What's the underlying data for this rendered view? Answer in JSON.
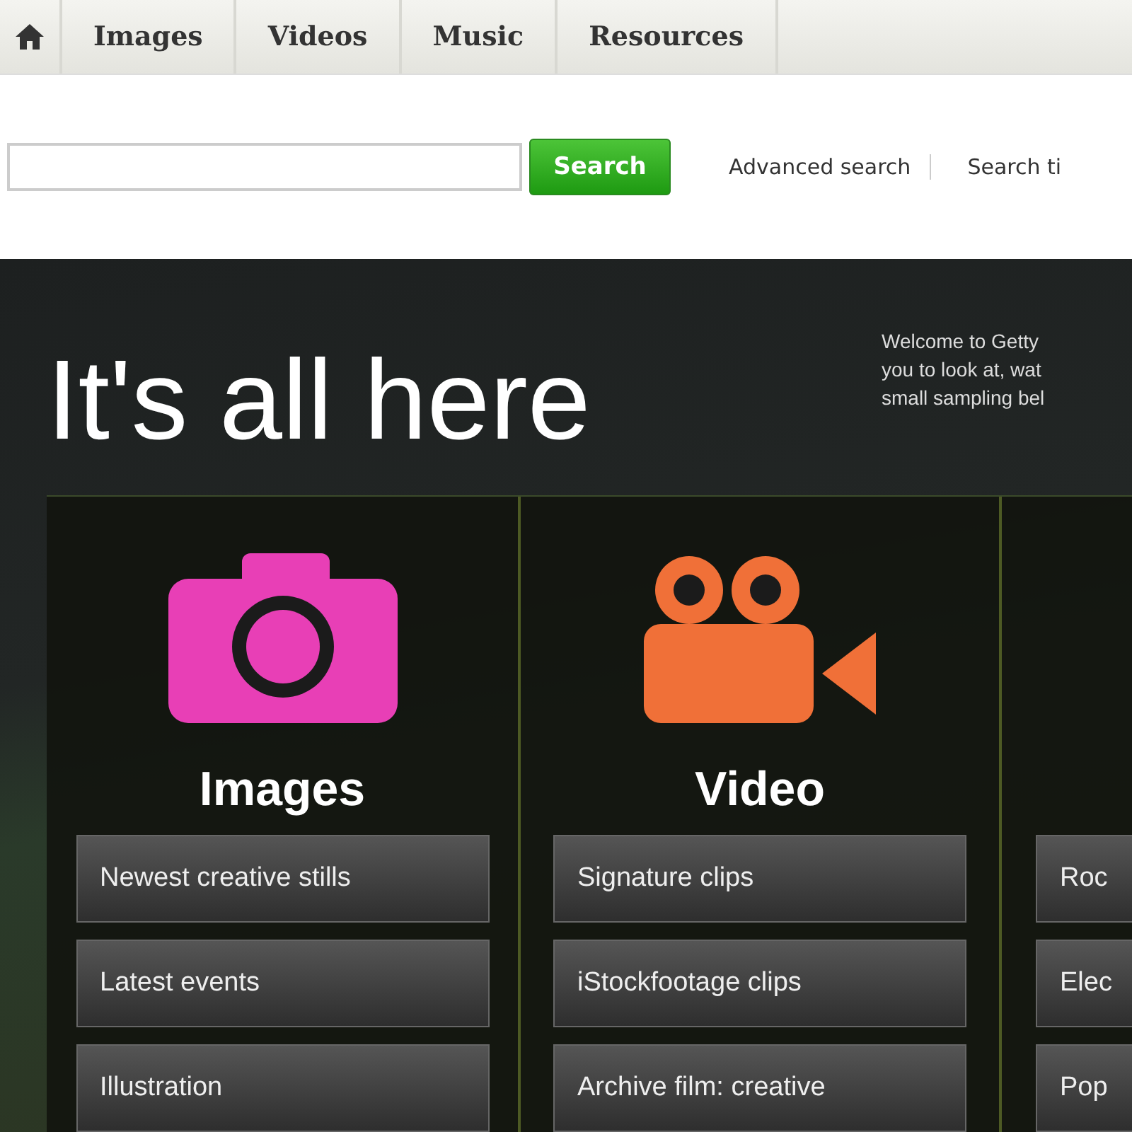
{
  "nav": {
    "tabs": [
      "Images",
      "Videos",
      "Music",
      "Resources"
    ]
  },
  "search": {
    "button": "Search",
    "links": [
      "Advanced search",
      "Search ti"
    ]
  },
  "hero": {
    "heading": "It's all here",
    "intro_lines": [
      "Welcome to Getty",
      "you to look at, wat",
      "small sampling bel"
    ]
  },
  "columns": [
    {
      "kind": "camera",
      "title": "Images",
      "links": [
        "Newest creative stills",
        "Latest events",
        "Illustration"
      ]
    },
    {
      "kind": "video",
      "title": "Video",
      "links": [
        "Signature clips",
        "iStockfootage clips",
        "Archive film: creative"
      ]
    },
    {
      "links": [
        "Roc",
        "Elec",
        "Pop"
      ]
    }
  ]
}
